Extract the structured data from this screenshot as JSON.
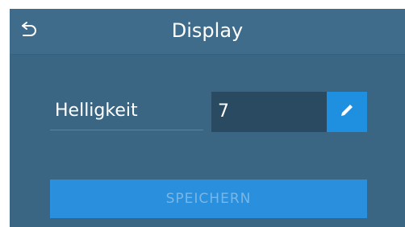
{
  "header": {
    "title": "Display",
    "back_icon": "undo-arrow-icon"
  },
  "setting": {
    "label": "Helligkeit",
    "value": "7",
    "edit_icon": "pencil-icon"
  },
  "footer": {
    "save_label": "SPEICHERN"
  },
  "colors": {
    "background": "#3a6683",
    "header": "#3f6c8a",
    "value_box": "#294a60",
    "accent": "#1f8fe0",
    "save_button": "#2a8fdc",
    "save_text_disabled": "#79b7e6"
  }
}
